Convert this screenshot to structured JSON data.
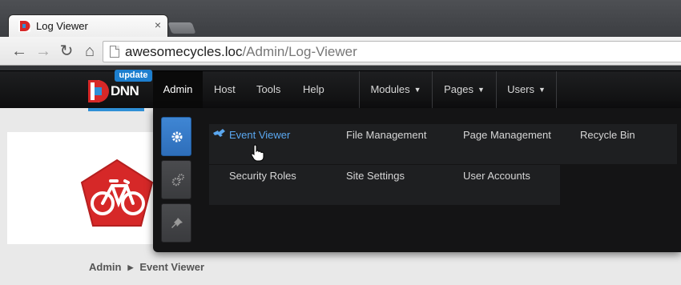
{
  "browser": {
    "tab_title": "Log Viewer",
    "tab_close": "×",
    "url_host": "awesomecycles.loc",
    "url_path": "/Admin/Log-Viewer",
    "back_icon": "←",
    "forward_icon": "→",
    "reload_icon": "↻",
    "home_icon": "⌂"
  },
  "controlbar": {
    "logo_text": "DNN",
    "update_badge": "update",
    "admin": "Admin",
    "host": "Host",
    "tools": "Tools",
    "help": "Help",
    "modules": "Modules",
    "pages": "Pages",
    "users": "Users",
    "caret": "▼"
  },
  "megamenu": {
    "items": [
      {
        "label": "Event Viewer"
      },
      {
        "label": "File Management"
      },
      {
        "label": "Page Management"
      },
      {
        "label": "Recycle Bin"
      },
      {
        "label": "Security Roles"
      },
      {
        "label": "Site Settings"
      },
      {
        "label": "User Accounts"
      }
    ]
  },
  "breadcrumb": {
    "root": "Admin",
    "separator": "▶",
    "current": "Event Viewer"
  },
  "colors": {
    "accent": "#2f8fd6",
    "highlight_text": "#5aa7f0",
    "logo_red": "#d62828"
  }
}
